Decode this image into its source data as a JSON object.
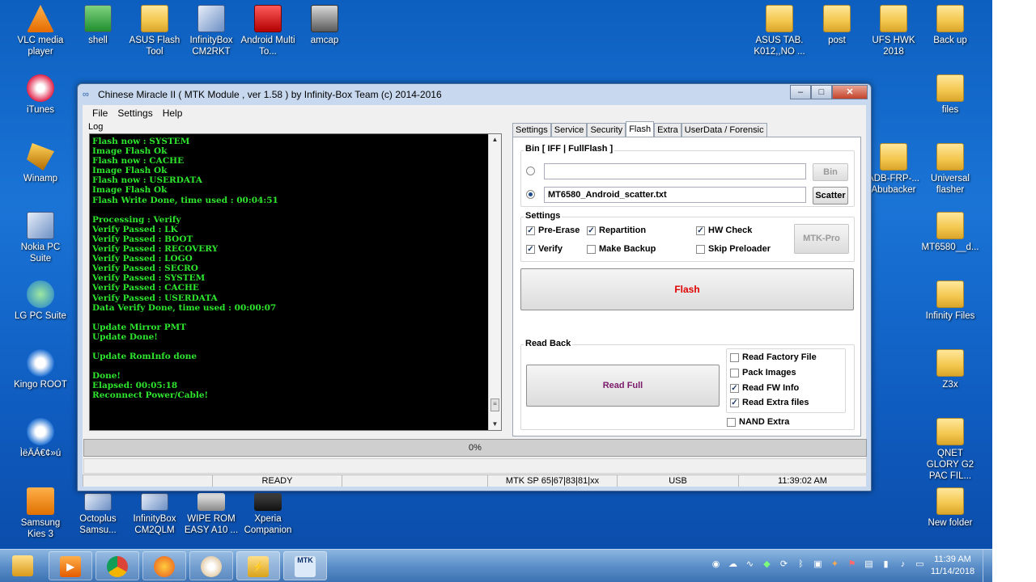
{
  "desktop": {
    "icons": [
      {
        "label": "VLC media player",
        "icon": "vlc-icon"
      },
      {
        "label": "shell",
        "icon": "shortcut-icon"
      },
      {
        "label": "ASUS Flash Tool",
        "icon": "asus-flash-icon"
      },
      {
        "label": "InfinityBox CM2RKT",
        "icon": "infinitybox-icon"
      },
      {
        "label": "Android Multi To...",
        "icon": "android-multi-tool-icon"
      },
      {
        "label": "amcap",
        "icon": "camera-icon"
      },
      {
        "label": "ASUS TAB. K012,,NO ...",
        "icon": "folder-icon"
      },
      {
        "label": "post",
        "icon": "folder-icon"
      },
      {
        "label": "UFS HWK 2018",
        "icon": "folder-icon"
      },
      {
        "label": "Back up",
        "icon": "folder-icon"
      },
      {
        "label": "iTunes",
        "icon": "itunes-icon"
      },
      {
        "label": "files",
        "icon": "folder-icon"
      },
      {
        "label": "Winamp",
        "icon": "winamp-icon"
      },
      {
        "label": "ADB-FRP-... Abubacker",
        "icon": "folder-icon"
      },
      {
        "label": "Universal flasher",
        "icon": "folder-icon"
      },
      {
        "label": "Nokia PC Suite",
        "icon": "nokia-icon"
      },
      {
        "label": "MT6580__d...",
        "icon": "folder-icon"
      },
      {
        "label": "LG PC Suite",
        "icon": "lg-icon"
      },
      {
        "label": "Infinity Files",
        "icon": "folder-icon"
      },
      {
        "label": "Kingo ROOT",
        "icon": "kingo-icon"
      },
      {
        "label": "Z3x",
        "icon": "folder-icon"
      },
      {
        "label": "ÌëÄÁ€¢»ú",
        "icon": "app-icon"
      },
      {
        "label": "QNET GLORY G2 PAC FIL...",
        "icon": "folder-icon"
      },
      {
        "label": "Samsung Kies 3",
        "icon": "kies-icon"
      },
      {
        "label": "Octoplus Samsu...",
        "icon": "octoplus-icon"
      },
      {
        "label": "InfinityBox CM2QLM",
        "icon": "infinitybox-icon"
      },
      {
        "label": "WIPE ROM EASY A10 ...",
        "icon": "skull-icon"
      },
      {
        "label": "Xperia Companion",
        "icon": "xperia-icon"
      },
      {
        "label": "New folder",
        "icon": "folder-icon"
      }
    ]
  },
  "window": {
    "title": "Chinese Miracle II ( MTK Module , ver 1.58 ) by Infinity-Box Team (c) 2014-2016",
    "menu": [
      "File",
      "Settings",
      "Help"
    ],
    "log_label": "Log",
    "log_lines": [
      "Flash now : SYSTEM",
      "Image Flash Ok",
      "Flash now : CACHE",
      "Image Flash Ok",
      "Flash now : USERDATA",
      "Image Flash Ok",
      "Flash Write Done, time used : 00:04:51",
      "",
      "Processing : Verify",
      "Verify Passed : LK",
      "Verify Passed : BOOT",
      "Verify Passed : RECOVERY",
      "Verify Passed : LOGO",
      "Verify Passed : SECRO",
      "Verify Passed : SYSTEM",
      "Verify Passed : CACHE",
      "Verify Passed : USERDATA",
      "Data Verify Done, time used : 00:00:07",
      "",
      "Update Mirror PMT",
      "Update Done!",
      "",
      "Update RomInfo done",
      "",
      "Done!",
      "Elapsed: 00:05:18",
      "Reconnect Power/Cable!"
    ],
    "tabs": [
      "Settings",
      "Service",
      "Security",
      "Flash",
      "Extra",
      "UserData / Forensic"
    ],
    "active_tab": "Flash",
    "bin": {
      "title": "Bin  [ IFF | FullFlash ]",
      "file_value": "",
      "scatter_value": "MT6580_Android_scatter.txt",
      "bin_button": "Bin",
      "scatter_button": "Scatter"
    },
    "settings": {
      "title": "Settings",
      "options": [
        {
          "label": "Pre-Erase",
          "checked": "true"
        },
        {
          "label": "Repartition",
          "checked": "true"
        },
        {
          "label": "HW Check",
          "checked": "true"
        },
        {
          "label": "Verify",
          "checked": "true"
        },
        {
          "label": "Make Backup",
          "checked": "false"
        },
        {
          "label": "Skip Preloader",
          "checked": "false"
        }
      ],
      "mtk_pro_button": "MTK-Pro"
    },
    "flash_button": "Flash",
    "read_back": {
      "title": "Read Back",
      "read_full_button": "Read Full",
      "options": [
        {
          "label": "Read Factory File",
          "checked": "false"
        },
        {
          "label": "Pack Images",
          "checked": "false"
        },
        {
          "label": "Read FW Info",
          "checked": "true"
        },
        {
          "label": "Read Extra files",
          "checked": "true"
        }
      ],
      "nand_extra": {
        "label": "NAND Extra",
        "checked": "false"
      }
    },
    "progress_text": "0%",
    "status": {
      "state": "READY",
      "chip": "MTK SP 65|67|83|81|xx",
      "port": "USB",
      "time": "11:39:02 AM"
    }
  },
  "taskbar": {
    "apps": [
      "windows-explorer",
      "media-player",
      "chrome",
      "firefox",
      "paint",
      "cm2-flash",
      "mtk-tool"
    ],
    "mtk_label": "MTK",
    "clock_time": "11:39 AM",
    "clock_date": "11/14/2018"
  }
}
